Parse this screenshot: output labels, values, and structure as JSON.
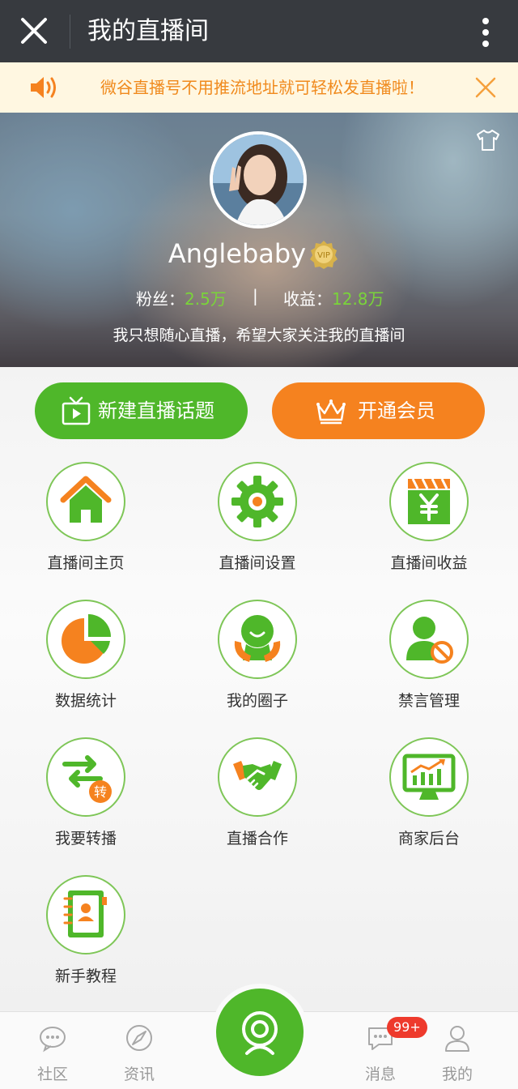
{
  "topbar": {
    "title": "我的直播间"
  },
  "notice": {
    "text": "微谷直播号不用推流地址就可轻松发直播啦！"
  },
  "profile": {
    "name": "Anglebaby",
    "vip_text": "VIP",
    "fans_label": "粉丝：",
    "fans_value": "2.5万",
    "separator": "|",
    "income_label": "收益：",
    "income_value": "12.8万",
    "bio": "我只想随心直播，希望大家关注我的直播间"
  },
  "actions": {
    "new_topic": "新建直播话题",
    "open_vip": "开通会员"
  },
  "grid": [
    {
      "label": "直播间主页",
      "icon": "home-icon"
    },
    {
      "label": "直播间设置",
      "icon": "gear-icon"
    },
    {
      "label": "直播间收益",
      "icon": "income-icon"
    },
    {
      "label": "数据统计",
      "icon": "pie-chart-icon"
    },
    {
      "label": "我的圈子",
      "icon": "circle-icon"
    },
    {
      "label": "禁言管理",
      "icon": "mute-user-icon"
    },
    {
      "label": "我要转播",
      "icon": "rebroadcast-icon",
      "badge_char": "转"
    },
    {
      "label": "直播合作",
      "icon": "handshake-icon"
    },
    {
      "label": "商家后台",
      "icon": "merchant-chart-icon"
    },
    {
      "label": "新手教程",
      "icon": "tutorial-book-icon"
    }
  ],
  "bottomnav": {
    "community": "社区",
    "news": "资讯",
    "messages": "消息",
    "mine": "我的",
    "badge": "99+"
  },
  "colors": {
    "green": "#4fb72a",
    "orange": "#f5821f",
    "topbar": "#373a3f"
  }
}
